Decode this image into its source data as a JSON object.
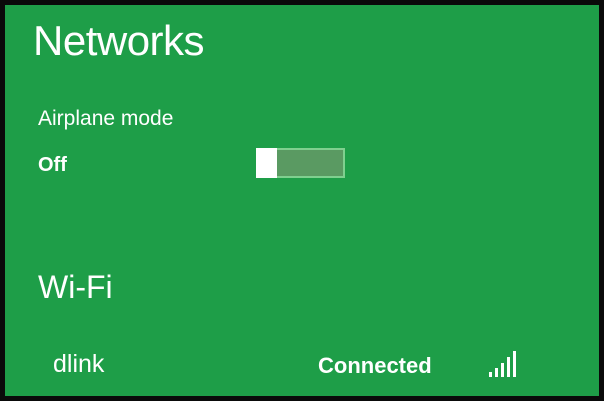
{
  "panel": {
    "title": "Networks"
  },
  "airplane_mode": {
    "label": "Airplane mode",
    "state_label": "Off",
    "enabled": false
  },
  "wifi": {
    "section_title": "Wi-Fi",
    "networks": [
      {
        "name": "dlink",
        "status": "Connected",
        "signal_icon": "signal-strength-icon",
        "signal_bars": 5
      }
    ]
  },
  "colors": {
    "background": "#1e9e48",
    "border": "#0a0a0a",
    "text": "#ffffff",
    "toggle_track": "#5a9a62",
    "toggle_border": "#7fd08f"
  }
}
